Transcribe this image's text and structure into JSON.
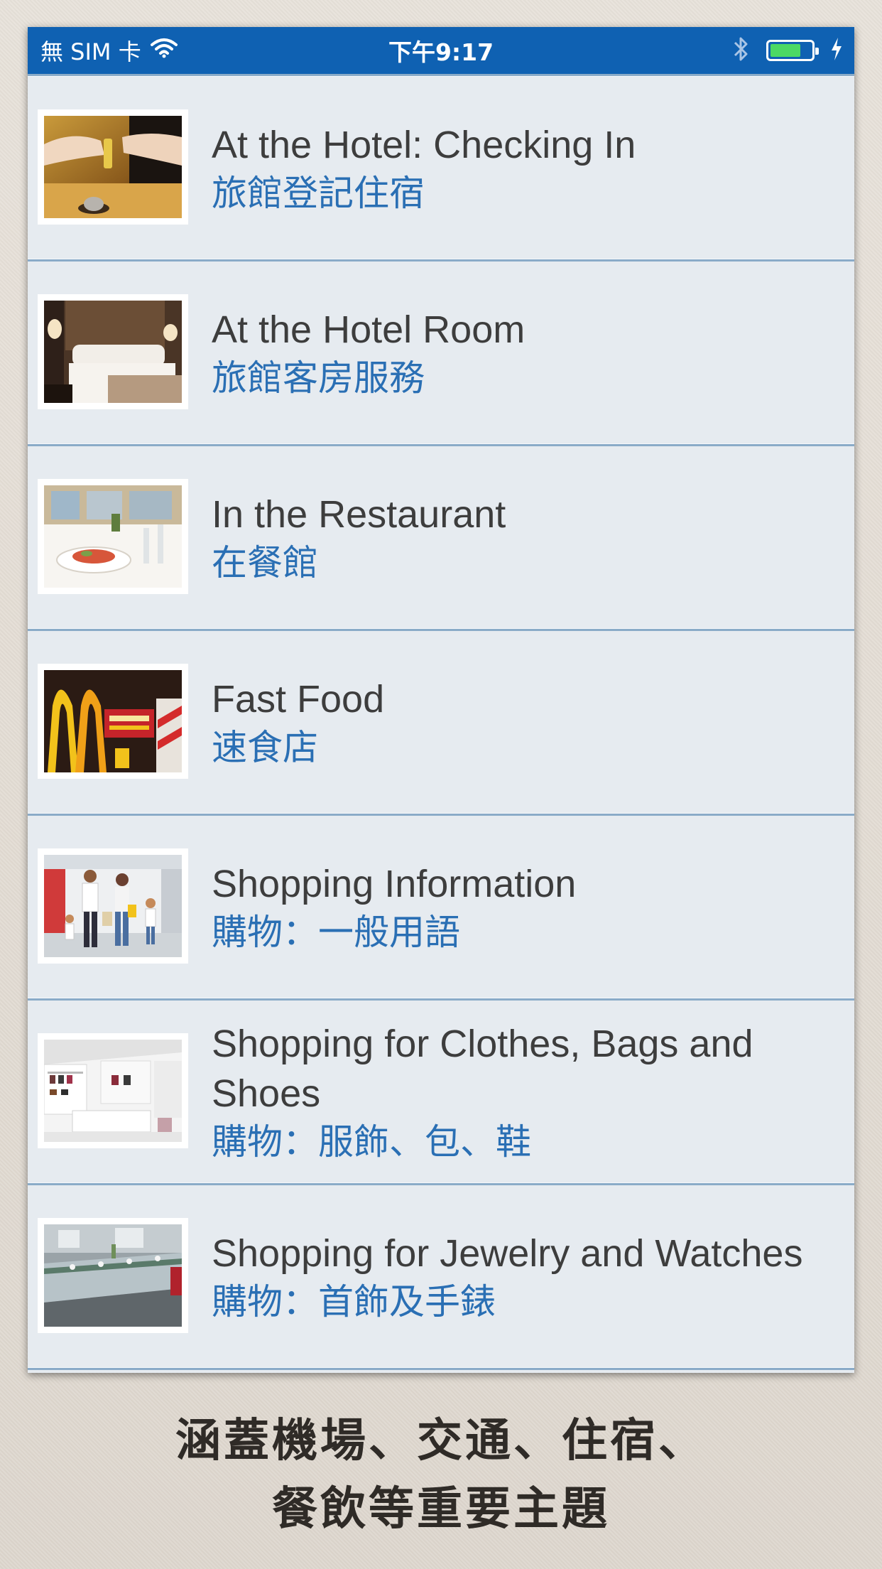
{
  "status_bar": {
    "carrier": "無 SIM 卡",
    "time": "下午9:17",
    "battery_level": 0.75,
    "colors": {
      "background": "#0f61b2",
      "battery_fill": "#4cd964"
    }
  },
  "list": {
    "items": [
      {
        "title": "At the Hotel: Checking In",
        "subtitle": "旅館登記住宿",
        "thumbnail": "hotel-checkin-photo"
      },
      {
        "title": "At the Hotel Room",
        "subtitle": "旅館客房服務",
        "thumbnail": "hotel-room-photo"
      },
      {
        "title": "In the Restaurant",
        "subtitle": "在餐館",
        "thumbnail": "restaurant-photo"
      },
      {
        "title": "Fast Food",
        "subtitle": "速食店",
        "thumbnail": "fast-food-photo"
      },
      {
        "title": "Shopping Information",
        "subtitle": "購物：一般用語",
        "thumbnail": "shopping-family-photo"
      },
      {
        "title": "Shopping for Clothes, Bags and Shoes",
        "subtitle": "購物：服飾、包、鞋",
        "thumbnail": "clothing-store-photo"
      },
      {
        "title": "Shopping for Jewelry and Watches",
        "subtitle": "購物：首飾及手錶",
        "thumbnail": "jewelry-store-photo"
      }
    ],
    "colors": {
      "title": "#3d3d3d",
      "subtitle": "#2a6fb4",
      "divider": "#8aabc8",
      "row_bg": "#e6ebf0"
    }
  },
  "caption": {
    "line1": "涵蓋機場、交通、住宿、",
    "line2": "餐飲等重要主題"
  }
}
